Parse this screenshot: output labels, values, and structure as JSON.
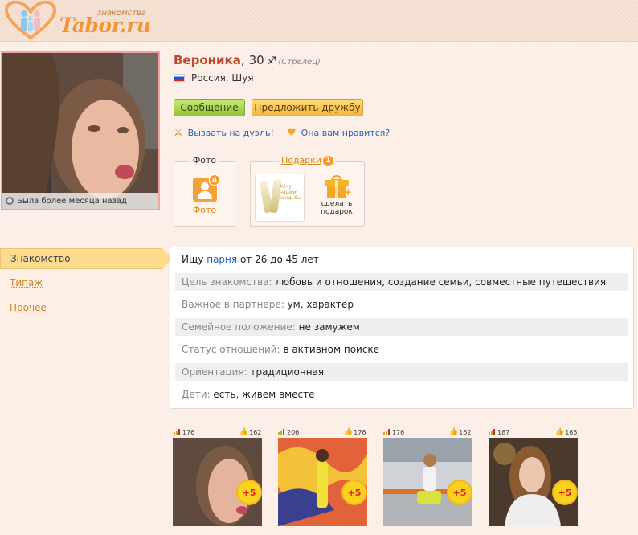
{
  "site": {
    "logo_small": "знакомства",
    "logo_big": "Tabor.ru"
  },
  "profile": {
    "name": "Вероника",
    "age": "30",
    "zodiac": "(Стрелец)",
    "location": "Россия, Шуя",
    "last_seen": "Была более месяца назад"
  },
  "actions": {
    "message_label": "Сообщение",
    "friend_label": "Предложить дружбу",
    "duel_label": "Вызвать на дуэль!",
    "like_label": "Она вам нравится?"
  },
  "photos_box": {
    "title": "Фото",
    "count": "4",
    "link": "Фото"
  },
  "gifts_box": {
    "title": "Подарки",
    "count": "1",
    "gift_text": "Хочу нашей свадьбы",
    "make_gift": "сделать подарок"
  },
  "nav": {
    "active": "Знакомство",
    "items": [
      "Типаж",
      "Прочее"
    ]
  },
  "info": {
    "seeking_prefix": "Ищу",
    "seeking_link": "парня",
    "seeking_suffix": "от 26 до 45 лет",
    "rows": [
      {
        "label": "Цель знакомства:",
        "value": "любовь и отношения, создание семьи, совместные путешествия"
      },
      {
        "label": "Важное в партнере:",
        "value": "ум, характер"
      },
      {
        "label": "Семейное положение:",
        "value": "не замужем"
      },
      {
        "label": "Статус отношений:",
        "value": "в активном поиске"
      },
      {
        "label": "Ориентация:",
        "value": "традиционная"
      },
      {
        "label": "Дети:",
        "value": "есть, живем вместе"
      }
    ]
  },
  "gallery": [
    {
      "views": "176",
      "likes": "162",
      "bonus": "+5"
    },
    {
      "views": "206",
      "likes": "176",
      "bonus": "+5"
    },
    {
      "views": "176",
      "likes": "162",
      "bonus": "+5"
    },
    {
      "views": "187",
      "likes": "165",
      "bonus": "+5"
    }
  ],
  "colors": {
    "page_bg": "#fcefe7",
    "name": "#c0462c",
    "link_blue": "#2a62b8",
    "accent_orange": "#f19538",
    "message_button": "#8fc23a",
    "friend_button": "#f3b53b",
    "nav_active": "#fddb8f"
  },
  "icons": {
    "zodiac": "sagittarius-icon",
    "duel": "crossed-swords-icon",
    "like": "heart-icon",
    "photo": "user-photo-icon",
    "gift": "gift-box-icon",
    "views": "bar-chart-icon",
    "likes": "thumbs-up-icon"
  }
}
